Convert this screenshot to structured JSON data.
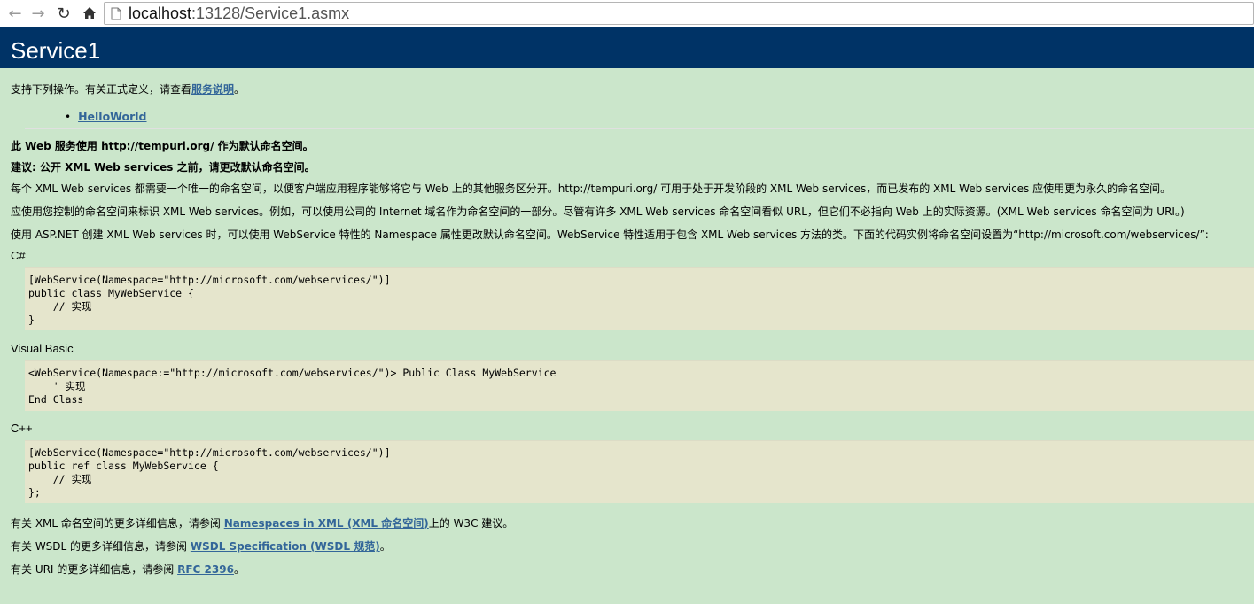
{
  "browser": {
    "url_host": "localhost",
    "url_rest": ":13128/Service1.asmx"
  },
  "page": {
    "title": "Service1",
    "intro_prefix": "支持下列操作。有关正式定义，请查看",
    "intro_link": "服务说明",
    "intro_suffix": "。",
    "operations": [
      "HelloWorld"
    ],
    "ns_notice": "此 Web 服务使用 http://tempuri.org/ 作为默认命名空间。",
    "recommendation": "建议: 公开 XML Web services 之前，请更改默认命名空间。",
    "para1": "每个 XML Web services 都需要一个唯一的命名空间，以便客户端应用程序能够将它与 Web 上的其他服务区分开。http://tempuri.org/ 可用于处于开发阶段的 XML Web services，而已发布的 XML Web services 应使用更为永久的命名空间。",
    "para2": "应使用您控制的命名空间来标识 XML Web services。例如，可以使用公司的 Internet 域名作为命名空间的一部分。尽管有许多 XML Web services 命名空间看似 URL，但它们不必指向 Web 上的实际资源。(XML Web services 命名空间为 URI。)",
    "para3": "使用 ASP.NET 创建 XML Web services 时，可以使用 WebService 特性的 Namespace 属性更改默认命名空间。WebService 特性适用于包含 XML Web services 方法的类。下面的代码实例将命名空间设置为“http://microsoft.com/webservices/”:",
    "csharp_label": "C#",
    "csharp_code": "[WebService(Namespace=\"http://microsoft.com/webservices/\")]\npublic class MyWebService {\n    // 实现\n}",
    "vb_label": "Visual Basic",
    "vb_code": "<WebService(Namespace:=\"http://microsoft.com/webservices/\")> Public Class MyWebService\n    ' 实现\nEnd Class",
    "cpp_label": "C++",
    "cpp_code": "[WebService(Namespace=\"http://microsoft.com/webservices/\")]\npublic ref class MyWebService {\n    // 实现\n};",
    "xml_ns_prefix": "有关 XML 命名空间的更多详细信息，请参阅 ",
    "xml_ns_link": "Namespaces in XML (XML 命名空间)",
    "xml_ns_suffix": "上的 W3C 建议。",
    "wsdl_prefix": "有关 WSDL 的更多详细信息，请参阅 ",
    "wsdl_link": "WSDL Specification (WSDL 规范)",
    "wsdl_suffix": "。",
    "uri_prefix": "有关 URI 的更多详细信息，请参阅 ",
    "uri_link": "RFC 2396",
    "uri_suffix": "。"
  },
  "colors": {
    "header_bg": "#003366",
    "page_bg": "#cbe6cb",
    "code_bg": "#e5e5cc",
    "link": "#336699"
  }
}
